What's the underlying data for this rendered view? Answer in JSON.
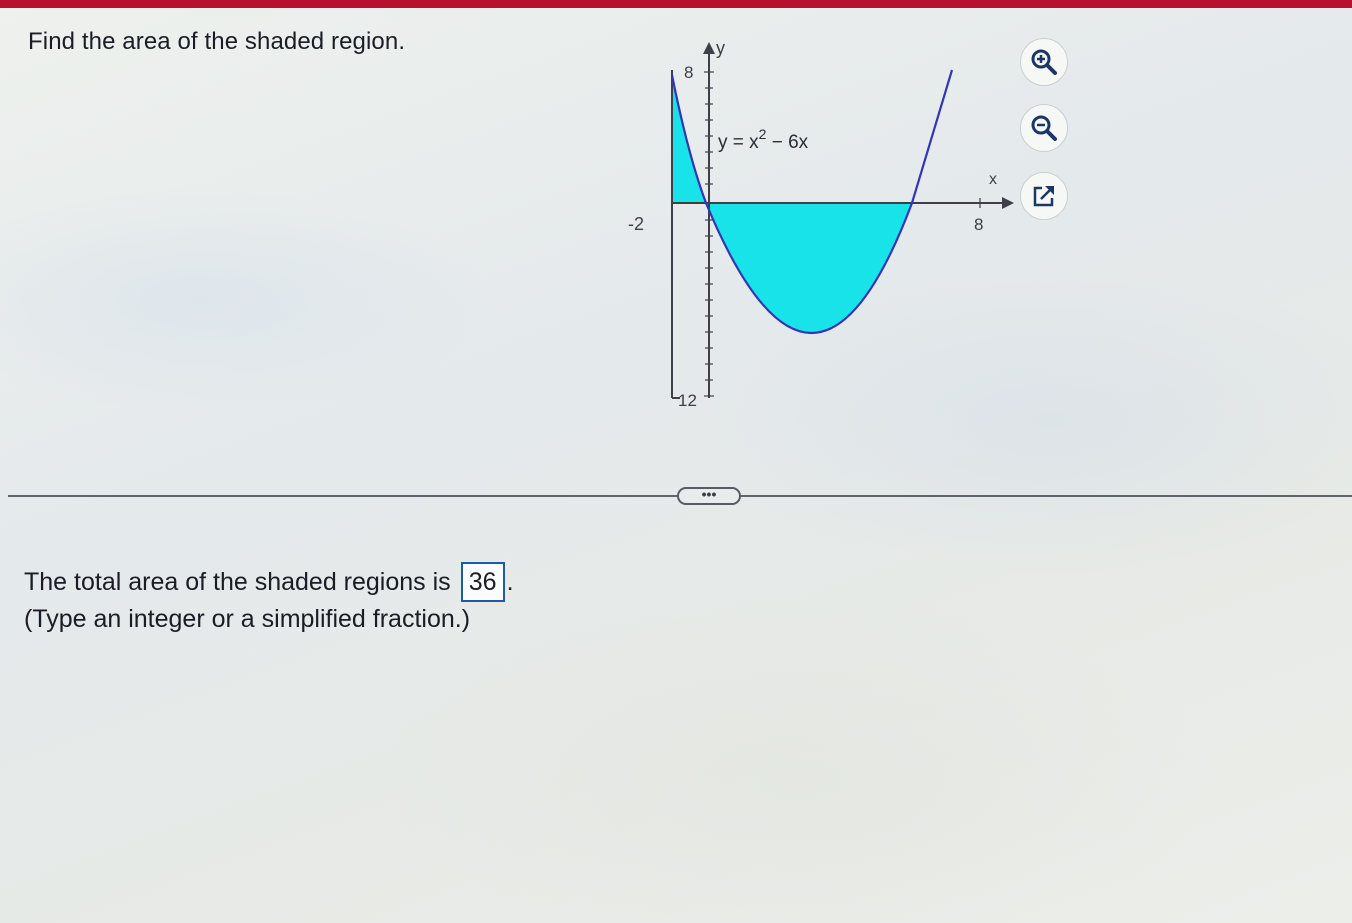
{
  "question": {
    "text": "Find the area of the shaded region."
  },
  "graph": {
    "y_axis_label": "y",
    "x_axis_label": "x",
    "y_top_tick": "8",
    "y_bottom_tick": "12",
    "x_left_tick": "-2",
    "x_right_tick": "8",
    "curve_label_prefix": "y = x",
    "curve_label_exp": "2",
    "curve_label_suffix": " − 6x",
    "fill_color": "#17e3e8",
    "curve_color": "#3434b5"
  },
  "tools": {
    "zoom_in_icon": "zoom-in-icon",
    "zoom_out_icon": "zoom-out-icon",
    "popout_icon": "external-link-icon"
  },
  "divider": {
    "more_label": "•••"
  },
  "answer": {
    "prefix": "The total area of the shaded regions is",
    "value": "36",
    "suffix": ".",
    "hint": "(Type an integer or a simplified fraction.)"
  }
}
